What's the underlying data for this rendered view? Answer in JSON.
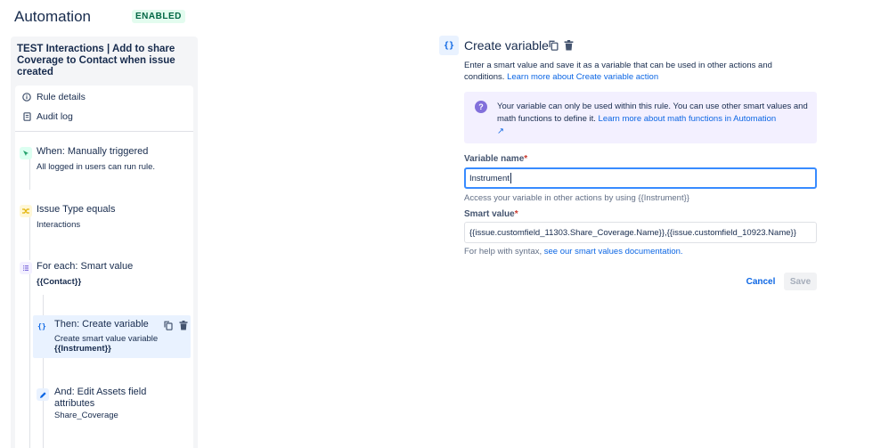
{
  "header": {
    "title": "Automation",
    "status_badge": "ENABLED"
  },
  "sidebar": {
    "rule_title": "TEST Interactions | Add to share Coverage to Contact when issue created",
    "nav": [
      {
        "label": "Rule details",
        "icon": "info-icon"
      },
      {
        "label": "Audit log",
        "icon": "document-icon"
      }
    ],
    "steps": [
      {
        "title": "When: Manually triggered",
        "subtitle": "All logged in users can run rule.",
        "icon": "trigger-icon",
        "color": "#22a06b"
      },
      {
        "title": "Issue Type equals",
        "subtitle": "Interactions",
        "icon": "shuffle-icon",
        "color": "#e2b203"
      },
      {
        "title": "For each: Smart value",
        "subtitle": "{{Contact}}",
        "icon": "branch-list-icon",
        "color": "#8270db"
      },
      {
        "title": "Then: Create variable",
        "subtitle": "Create smart value variable",
        "subtitle2": "{{Instrument}}",
        "icon": "braces-icon",
        "selected": true
      },
      {
        "title_line1": "And: Edit Assets field",
        "title_line2": "attributes",
        "subtitle": "Share_Coverage",
        "icon": "pencil-icon"
      }
    ]
  },
  "main": {
    "title": "Create variable",
    "icon_glyph": "{}",
    "description": "Enter a smart value and save it as a variable that can be used in other actions and conditions. ",
    "description_link": "Learn more about Create variable action",
    "info": {
      "text": "Your variable can only be used within this rule. You can use other smart values and math functions to define it. ",
      "link": "Learn more about math functions in Automation",
      "link_arrow": "↗"
    },
    "variable_name": {
      "label": "Variable name",
      "required": "*",
      "value": "Instrument",
      "helper": "Access your variable in other actions by using {{Instrument}}"
    },
    "smart_value": {
      "label": "Smart value",
      "required": "*",
      "value": "{{issue.customfield_11303.Share_Coverage.Name}},{{issue.customfield_10923.Name}}",
      "helper_text": "For help with syntax, ",
      "helper_link": "see our smart values documentation."
    },
    "buttons": {
      "cancel": "Cancel",
      "save": "Save"
    }
  }
}
